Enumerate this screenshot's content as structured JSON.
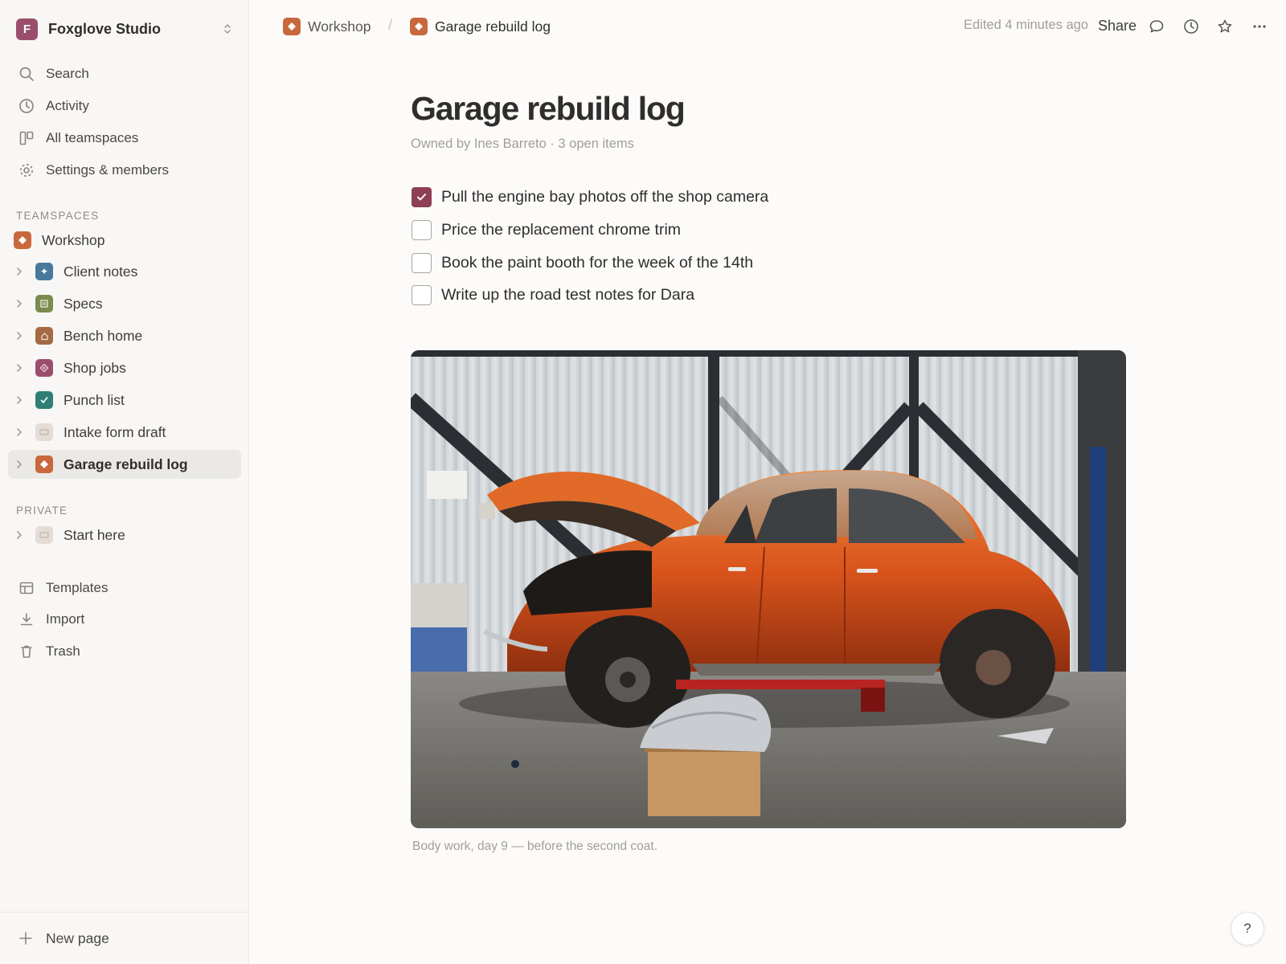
{
  "workspace": {
    "initial": "F",
    "name": "Foxglove Studio"
  },
  "nav": {
    "search": "Search",
    "activity": "Activity",
    "teamspaces": "All teamspaces",
    "settings": "Settings & members"
  },
  "sections": {
    "teamspaces": "TEAMSPACES",
    "private": "PRIVATE"
  },
  "teamspace": {
    "name": "Workshop"
  },
  "pages": [
    {
      "label": "Client notes",
      "icon": "sparkle-icon",
      "color": "#4a7a9b"
    },
    {
      "label": "Specs",
      "icon": "document-icon",
      "color": "#7c8a4f"
    },
    {
      "label": "Bench home",
      "icon": "home-icon",
      "color": "#a36a44"
    },
    {
      "label": "Shop jobs",
      "icon": "diamond-icon",
      "color": "#9b4e6c"
    },
    {
      "label": "Punch list",
      "icon": "check-icon",
      "color": "#2f7f74"
    },
    {
      "label": "Intake form draft",
      "icon": "blank-page-icon",
      "color": "#d6cfc8"
    },
    {
      "label": "Garage rebuild log",
      "icon": "orange-diamond-icon",
      "color": "#c8683c"
    }
  ],
  "private_pages": [
    {
      "label": "Start here",
      "icon": "blank-page-icon",
      "color": "#d6cfc8"
    }
  ],
  "footer_nav": {
    "templates": "Templates",
    "import": "Import",
    "trash": "Trash"
  },
  "new_page": "New page",
  "topbar": {
    "crumb_workspace": "Workshop",
    "separator": "/",
    "crumb_page": "Garage rebuild log",
    "edited": "Edited 4 minutes ago",
    "share": "Share"
  },
  "page": {
    "title": "Garage rebuild log",
    "meta": "Owned by Ines Barreto · 3 open items",
    "todos": [
      {
        "text": "Pull the engine bay photos off the shop camera",
        "checked": true
      },
      {
        "text": "Price the replacement chrome trim",
        "checked": false
      },
      {
        "text": "Book the paint booth for the week of the 14th",
        "checked": false
      },
      {
        "text": "Write up the road test notes for Dara",
        "checked": false
      }
    ],
    "caption": "Body work, day 9 — before the second coat."
  },
  "help": "?",
  "colors": {
    "accent": "#8c3f55",
    "brand": "#9b4e6c",
    "page_icon": "#c8683c"
  }
}
